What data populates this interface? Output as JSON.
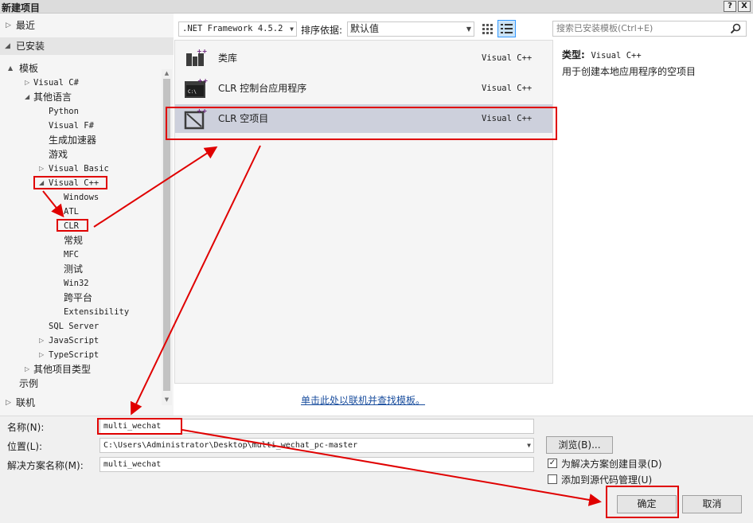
{
  "window": {
    "title": "新建项目",
    "help_btn": "?",
    "close_btn": "X"
  },
  "left_nav": {
    "recent": "最近",
    "installed": "已安装",
    "tree": [
      {
        "label": "模板",
        "indent": 0,
        "tri": "▲"
      },
      {
        "label": "Visual C#",
        "indent": 1,
        "tri": "▷"
      },
      {
        "label": "其他语言",
        "indent": 1,
        "tri": "◢"
      },
      {
        "label": "Python",
        "indent": 2,
        "tri": ""
      },
      {
        "label": "Visual F#",
        "indent": 2,
        "tri": ""
      },
      {
        "label": "生成加速器",
        "indent": 2,
        "tri": ""
      },
      {
        "label": "游戏",
        "indent": 2,
        "tri": ""
      },
      {
        "label": "Visual Basic",
        "indent": 2,
        "tri": "▷"
      },
      {
        "label": "Visual C++",
        "indent": 2,
        "tri": "◢"
      },
      {
        "label": "Windows",
        "indent": 3,
        "tri": ""
      },
      {
        "label": "ATL",
        "indent": 3,
        "tri": ""
      },
      {
        "label": "CLR",
        "indent": 3,
        "tri": ""
      },
      {
        "label": "常规",
        "indent": 3,
        "tri": ""
      },
      {
        "label": "MFC",
        "indent": 3,
        "tri": ""
      },
      {
        "label": "测试",
        "indent": 3,
        "tri": ""
      },
      {
        "label": "Win32",
        "indent": 3,
        "tri": ""
      },
      {
        "label": "跨平台",
        "indent": 3,
        "tri": ""
      },
      {
        "label": "Extensibility",
        "indent": 3,
        "tri": ""
      },
      {
        "label": "SQL Server",
        "indent": 2,
        "tri": ""
      },
      {
        "label": "JavaScript",
        "indent": 2,
        "tri": "▷"
      },
      {
        "label": "TypeScript",
        "indent": 2,
        "tri": "▷"
      },
      {
        "label": "其他项目类型",
        "indent": 1,
        "tri": "▷"
      },
      {
        "label": "示例",
        "indent": 0,
        "tri": ""
      }
    ],
    "online": "联机"
  },
  "toolbar": {
    "framework": ".NET Framework 4.5.2",
    "sort_label": "排序依据:",
    "sort_value": "默认值",
    "search_placeholder": "搜索已安装模板(Ctrl+E)"
  },
  "templates": [
    {
      "name": "类库",
      "lang": "Visual C++",
      "icon": "class-library-icon",
      "selected": false
    },
    {
      "name": "CLR 控制台应用程序",
      "lang": "Visual C++",
      "icon": "console-app-icon",
      "selected": false
    },
    {
      "name": "CLR 空项目",
      "lang": "Visual C++",
      "icon": "empty-project-icon",
      "selected": true
    }
  ],
  "online_link": "单击此处以联机并查找模板。",
  "details": {
    "type_label": "类型:",
    "type_value": "Visual C++",
    "description": "用于创建本地应用程序的空项目"
  },
  "form": {
    "name_label": "名称(N):",
    "name_value": "multi_wechat",
    "location_label": "位置(L):",
    "location_value": "C:\\Users\\Administrator\\Desktop\\multi_wechat_pc-master",
    "solution_label": "解决方案名称(M):",
    "solution_value": "multi_wechat",
    "browse_label": "浏览(B)...",
    "create_dir_label": "为解决方案创建目录(D)",
    "create_dir_checked": true,
    "source_control_label": "添加到源代码管理(U)",
    "source_control_checked": false,
    "ok_label": "确定",
    "cancel_label": "取消"
  },
  "colors": {
    "annotation": "#e00000",
    "selection": "#cdd0dc",
    "link": "#1a4e9e"
  }
}
